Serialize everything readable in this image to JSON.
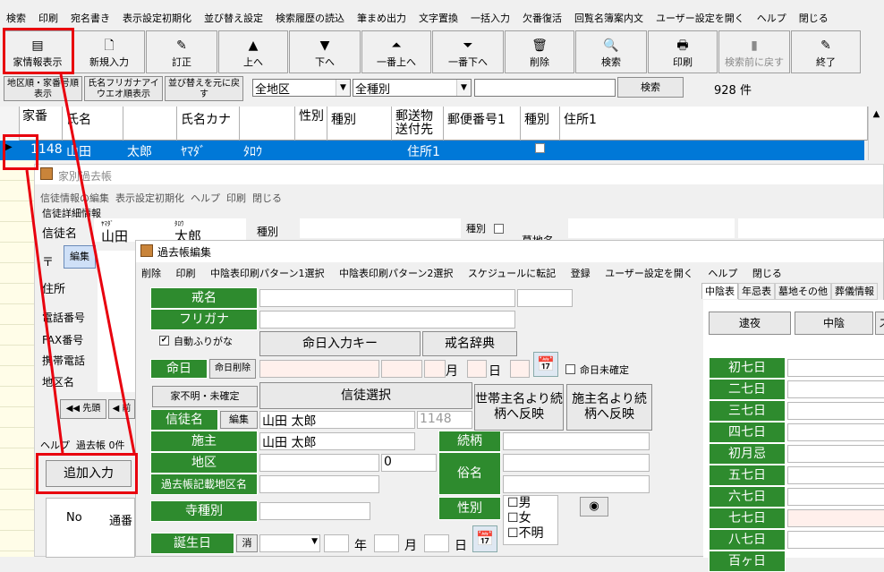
{
  "menu": [
    "検索",
    "印刷",
    "宛名書き",
    "表示設定初期化",
    "並び替え設定",
    "検索履歴の読込",
    "筆まめ出力",
    "文字置換",
    "一括入力",
    "欠番復活",
    "回覧名簿案内文",
    "ユーザー設定を開く",
    "ヘルプ",
    "閉じる"
  ],
  "toolbar": [
    {
      "label": "家情報表示",
      "icon": "▤"
    },
    {
      "label": "新規入力",
      "icon": "🗋"
    },
    {
      "label": "訂正",
      "icon": "✎"
    },
    {
      "label": "上へ",
      "icon": "▲"
    },
    {
      "label": "下へ",
      "icon": "▼"
    },
    {
      "label": "一番上へ",
      "icon": "⏶"
    },
    {
      "label": "一番下へ",
      "icon": "⏷"
    },
    {
      "label": "削除",
      "icon": "🗑"
    },
    {
      "label": "検索",
      "icon": "🔍"
    },
    {
      "label": "印刷",
      "icon": "🖶"
    },
    {
      "label": "検索前に戻す",
      "icon": "▮"
    },
    {
      "label": "終了",
      "icon": "✎"
    }
  ],
  "sortbar": {
    "btn1": "地区順・家番号順表示",
    "btn2": "氏名フリガナアイウエオ順表示",
    "btn3": "並び替えを元に戻す",
    "area": "全地区",
    "kind": "全種別",
    "search_value": "",
    "search_btn": "検索",
    "count": "928 件"
  },
  "grid": {
    "headers": [
      "家番",
      "氏名",
      "",
      "氏名カナ",
      "",
      "性別",
      "種別",
      "郵送物送付先",
      "郵便番号1",
      "種別",
      "住所1"
    ],
    "row": {
      "no": "1148",
      "sei": "山田",
      "mei": "太郎",
      "kana_sei": "ﾔﾏﾀﾞ",
      "kana_mei": "ﾀﾛｳ",
      "dest": "住所1"
    }
  },
  "kako_window": {
    "title": "家別過去帳",
    "menu": [
      "信徒情報の編集",
      "表示設定初期化",
      "ヘルプ",
      "印刷",
      "閉じる"
    ],
    "section": "信徒詳細情報",
    "shinto_label": "信徒名",
    "furigana_sei": "ﾔﾏﾀﾞ",
    "furigana_mei": "ﾀﾛｳ",
    "sei": "山田",
    "mei": "太郎",
    "shubetsu": "種別",
    "shubetsu2": "種別",
    "bochi": "墓地名",
    "zip": "〒",
    "edit": "編集",
    "addr": "住所",
    "tel": "電話番号",
    "fax": "FAX番号",
    "mobile": "携帯電話",
    "area": "地区名",
    "first": "◀◀ 先頭",
    "prev": "◀ 前へ",
    "help": "ヘルプ",
    "count": "過去帳 0件",
    "add": "追加入力",
    "col_no": "No",
    "col_tsuban": "通番"
  },
  "edit_window": {
    "title": "過去帳編集",
    "menu": [
      "削除",
      "印刷",
      "中陰表印刷パターン1選択",
      "中陰表印刷パターン2選択",
      "スケジュールに転記",
      "登録",
      "ユーザー設定を開く",
      "ヘルプ",
      "閉じる"
    ],
    "kaimyo": "戒名",
    "furigana": "フリガナ",
    "auto_furigana": "自動ふりがな",
    "meinichi_key": "命日入力キー",
    "kaimyo_dict": "戒名辞典",
    "meinichi": "命日",
    "meinichi_del": "命日削除",
    "month": "月",
    "day": "日",
    "unconfirmed": "命日未確定",
    "ie_fumei": "家不明・未確定",
    "shinto_sentaku": "信徒選択",
    "setai_btn": "世帯主名より続柄へ反映",
    "seshu_btn": "施主名より続柄へ反映",
    "shinto": "信徒名",
    "edit": "編集",
    "shinto_value": "山田  太郎",
    "shinto_no": "1148",
    "seshu": "施主",
    "seshu_value": "山田  太郎",
    "zokugara": "続柄",
    "chiku": "地区",
    "chiku_value": "0",
    "zokumei": "俗名",
    "kako_chiku": "過去帳記載地区名",
    "seibetsu": "性別",
    "male": "男",
    "female": "女",
    "unknown": "不明",
    "jishubetsu": "寺種別",
    "tanjobi": "誕生日",
    "clear": "消",
    "year": "年",
    "tabs": [
      "中陰表",
      "年忌表",
      "墓地その他",
      "葬儀情報"
    ],
    "cols": [
      "逮夜",
      "中陰",
      "スケ"
    ],
    "days": [
      "初七日",
      "二七日",
      "三七日",
      "四七日",
      "初月忌",
      "五七日",
      "六七日",
      "七七日",
      "八七日",
      "百ヶ日"
    ]
  }
}
